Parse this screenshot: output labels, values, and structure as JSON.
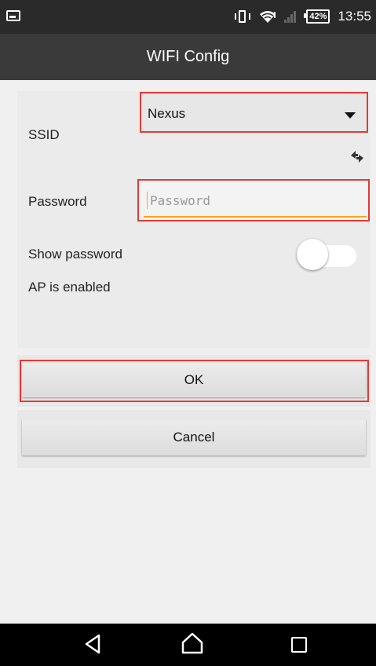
{
  "status_bar": {
    "battery": "42%",
    "time": "13:55"
  },
  "app_bar": {
    "title": "WIFI Config"
  },
  "form": {
    "ssid_label": "SSID",
    "ssid_value": "Nexus",
    "password_label": "Password",
    "password_placeholder": "Password",
    "show_password_label": "Show password",
    "show_password_on": false,
    "ap_status": "AP is enabled"
  },
  "buttons": {
    "ok": "OK",
    "cancel": "Cancel"
  },
  "colors": {
    "highlight": "#e53935",
    "input_focus": "#f4a51c"
  }
}
